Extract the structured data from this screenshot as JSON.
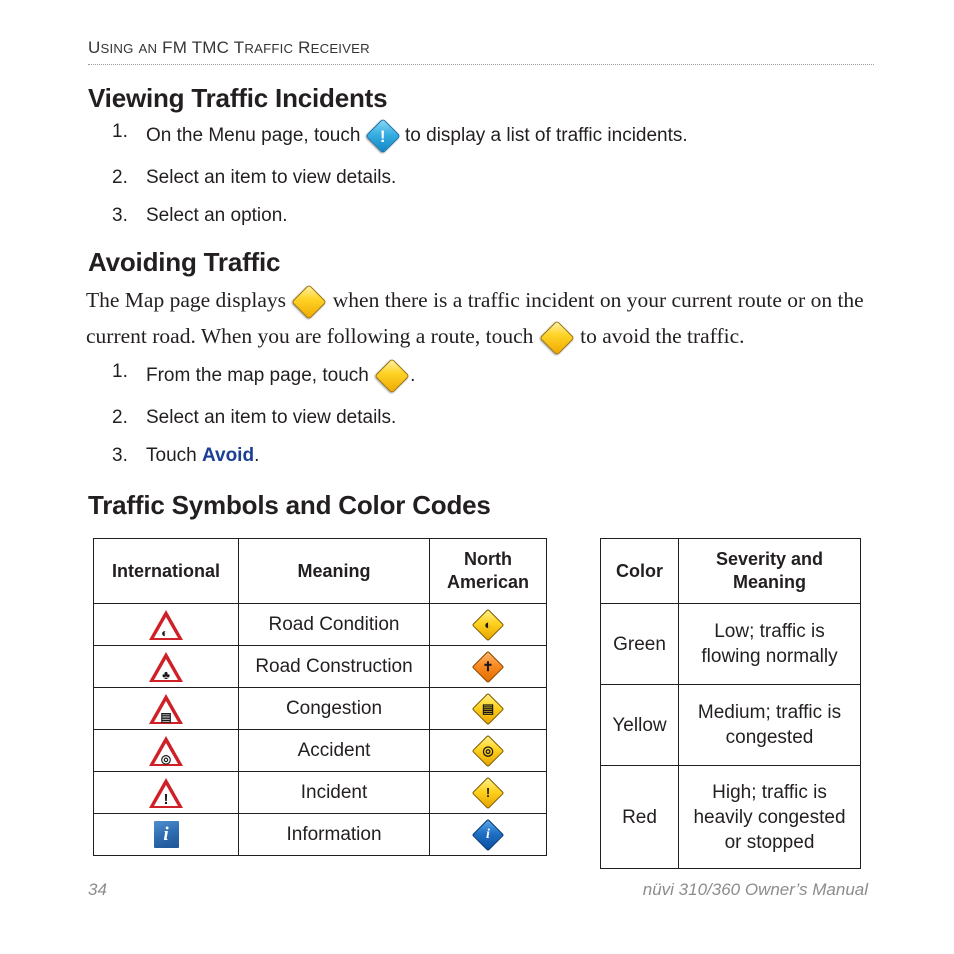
{
  "running_header": {
    "full_text": "Using an FM TMC Traffic Receiver",
    "parts": [
      {
        "cap": "U",
        "rest": "SING"
      },
      {
        "cap": "",
        "rest": " "
      },
      {
        "cap": "A",
        "rest": "N"
      },
      {
        "cap": " FM TMC",
        "rest": ""
      },
      {
        "cap": " T",
        "rest": "RAFFIC"
      },
      {
        "cap": " R",
        "rest": "ECEIVER"
      }
    ]
  },
  "headings": {
    "viewing": "Viewing Traffic Incidents",
    "avoiding": "Avoiding Traffic",
    "symbols": "Traffic Symbols and Color Codes"
  },
  "viewing_steps": [
    {
      "number": "1.",
      "before": "On the Menu page, touch ",
      "icon": "blue-exclamation-diamond-icon",
      "after": " to display a list of traffic incidents."
    },
    {
      "number": "2.",
      "before": "Select an item to view details.",
      "icon": "",
      "after": ""
    },
    {
      "number": "3.",
      "before": "Select an option.",
      "icon": "",
      "after": ""
    }
  ],
  "avoiding_paragraph": {
    "part1": "The Map page displays ",
    "icon1": "gold-diamond-icon",
    "part2": " when there is a traffic incident on your current route or on the current road. When you are following a route, touch ",
    "icon2": "gold-diamond-icon",
    "part3": " to avoid the traffic."
  },
  "avoiding_steps": [
    {
      "number": "1.",
      "before": "From the map page, touch ",
      "icon": "gold-diamond-icon",
      "after": "."
    },
    {
      "number": "2.",
      "before": "Select an item to view details.",
      "icon": "",
      "after": ""
    },
    {
      "number": "3.",
      "before": "Touch ",
      "icon": "",
      "bold_word": "Avoid",
      "after": "."
    }
  ],
  "symbols_table": {
    "headers": [
      "International",
      "Meaning",
      "North American"
    ],
    "header_north_american_line1": "North",
    "header_north_american_line2": "American",
    "rows": [
      {
        "meaning": "Road Condition",
        "international_icon": "road-condition-warning-triangle-icon",
        "international_glyph": "ᵕ",
        "north_american_icon": "road-condition-yellow-diamond-icon",
        "na_color": "yellow"
      },
      {
        "meaning": "Road Construction",
        "international_icon": "road-construction-warning-triangle-icon",
        "international_glyph": "ᵕ",
        "north_american_icon": "road-construction-orange-diamond-icon",
        "na_color": "orange"
      },
      {
        "meaning": "Congestion",
        "international_icon": "congestion-warning-triangle-icon",
        "international_glyph": "ᵕ",
        "north_american_icon": "congestion-yellow-diamond-icon",
        "na_color": "yellow"
      },
      {
        "meaning": "Accident",
        "international_icon": "accident-warning-triangle-icon",
        "international_glyph": "ᵕ",
        "north_american_icon": "accident-yellow-diamond-icon",
        "na_color": "yellow"
      },
      {
        "meaning": "Incident",
        "international_icon": "incident-warning-triangle-icon",
        "international_glyph": "!",
        "north_american_icon": "incident-yellow-diamond-icon",
        "na_color": "yellow",
        "na_glyph": "!"
      },
      {
        "meaning": "Information",
        "international_icon": "information-blue-square-icon",
        "international_glyph": "i",
        "north_american_icon": "information-blue-diamond-icon",
        "na_color": "navy",
        "na_glyph": "i"
      }
    ]
  },
  "colors_table": {
    "headers": [
      "Color",
      "Severity and Meaning"
    ],
    "header_severity_line1": "Severity and",
    "header_severity_line2": "Meaning",
    "rows": [
      {
        "color": "Green",
        "meaning": "Low; traffic is flowing normally"
      },
      {
        "color": "Yellow",
        "meaning": "Medium; traffic is congested"
      },
      {
        "color": "Red",
        "meaning": "High; traffic is heavily congested or stopped"
      }
    ]
  },
  "footer": {
    "page_number": "34",
    "manual_title": "nüvi 310/360 Owner’s Manual"
  },
  "colors": {
    "text": "#231f20",
    "link_blue": "#1b3f94",
    "footer_gray": "#8c8c8c",
    "triangle_red": "#cf2027",
    "diamond_gold": "#ffd427",
    "diamond_orange": "#f98b22",
    "diamond_blue": "#1f6fc4"
  }
}
